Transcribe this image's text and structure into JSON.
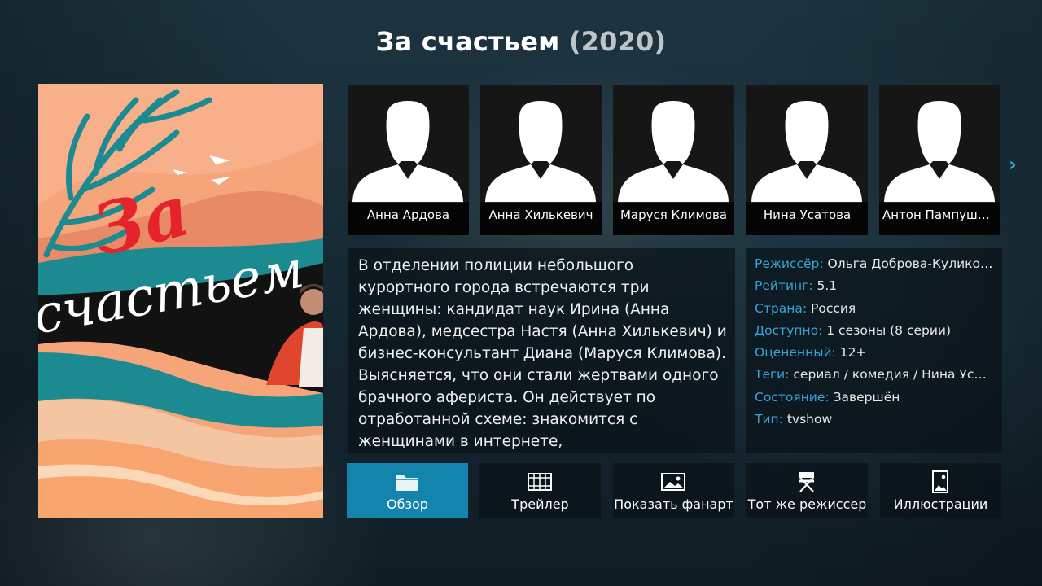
{
  "title": {
    "name": "За счастьем",
    "year": "2020",
    "open_paren": "(",
    "close_paren": ")"
  },
  "poster": {
    "title_line1": "За",
    "title_line2": "счастьем"
  },
  "cast": [
    {
      "name": "Анна Ардова"
    },
    {
      "name": "Анна Хилькевич"
    },
    {
      "name": "Маруся Климова"
    },
    {
      "name": "Нина Усатова"
    },
    {
      "name": "Антон Пампушный"
    }
  ],
  "plot": "В отделении полиции небольшого курортного города встречаются три женщины: кандидат наук Ирина (Анна Ардова), медсестра Настя (Анна Хилькевич) и бизнес-консультант Диана (Маруся Климова). Выясняется, что они стали жертвами одного брачного афериста. Он действует по отработанной схеме: знакомится с женщинами в интернете,",
  "info": [
    {
      "label": "Режиссёр:",
      "value": "Ольга Доброва-Куликова"
    },
    {
      "label": "Рейтинг:",
      "value": "5.1"
    },
    {
      "label": "Страна:",
      "value": "Россия"
    },
    {
      "label": "Доступно:",
      "value": "1 сезоны (8 серии)"
    },
    {
      "label": "Оцененный:",
      "value": "12+"
    },
    {
      "label": "Теги:",
      "value": "сериал / комедия / Нина Усатова"
    },
    {
      "label": "Состояние:",
      "value": "Завершён"
    },
    {
      "label": "Тип:",
      "value": "tvshow"
    }
  ],
  "buttons": [
    {
      "label": "Обзор",
      "icon": "folder-icon",
      "active": true
    },
    {
      "label": "Трейлер",
      "icon": "film-strip-icon",
      "active": false
    },
    {
      "label": "Показать фанарт",
      "icon": "fanart-image-icon",
      "active": false
    },
    {
      "label": "Тот же режиссер",
      "icon": "director-chair-icon",
      "active": false
    },
    {
      "label": "Иллюстрации",
      "icon": "artwork-icon",
      "active": false
    }
  ],
  "colors": {
    "accent": "#34a5d6",
    "active_button": "#1385ad",
    "poster_red": "#e5232b",
    "poster_teal": "#1b8a91"
  }
}
